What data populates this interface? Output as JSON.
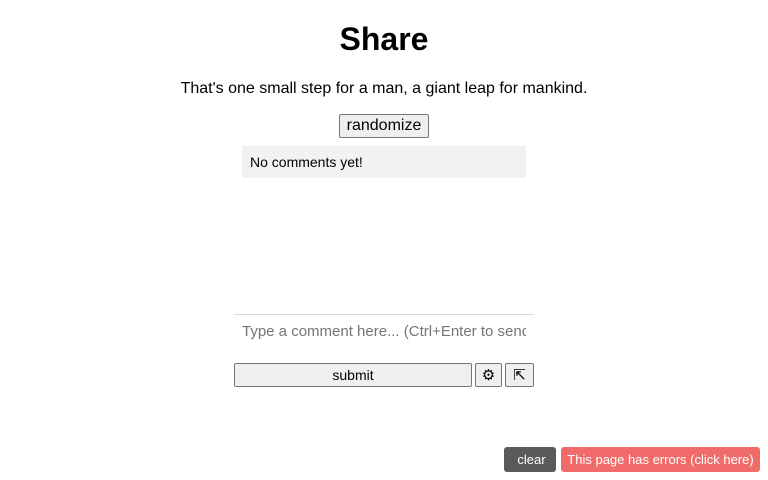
{
  "header": {
    "title": "Share"
  },
  "quote": {
    "text": "That's one small step for a man, a giant leap for mankind."
  },
  "randomize_label": "randomize",
  "comments": {
    "empty_text": "No comments yet!"
  },
  "composer": {
    "placeholder": "Type a comment here... (Ctrl+Enter to send)",
    "value": "",
    "submit_label": "submit",
    "settings_icon": "gear-icon",
    "settings_glyph": "⚙",
    "popout_icon": "arrow-up-left-to-corner-icon",
    "popout_glyph": "⇱"
  },
  "footer": {
    "clear_icon": "trash-icon",
    "clear_glyph": "",
    "clear_label": "clear",
    "errors_label": "This page has errors (click here)"
  },
  "colors": {
    "error_badge": "#f26b6b",
    "clear_badge": "#5a5a5a",
    "comments_bg": "#f2f2f2"
  }
}
